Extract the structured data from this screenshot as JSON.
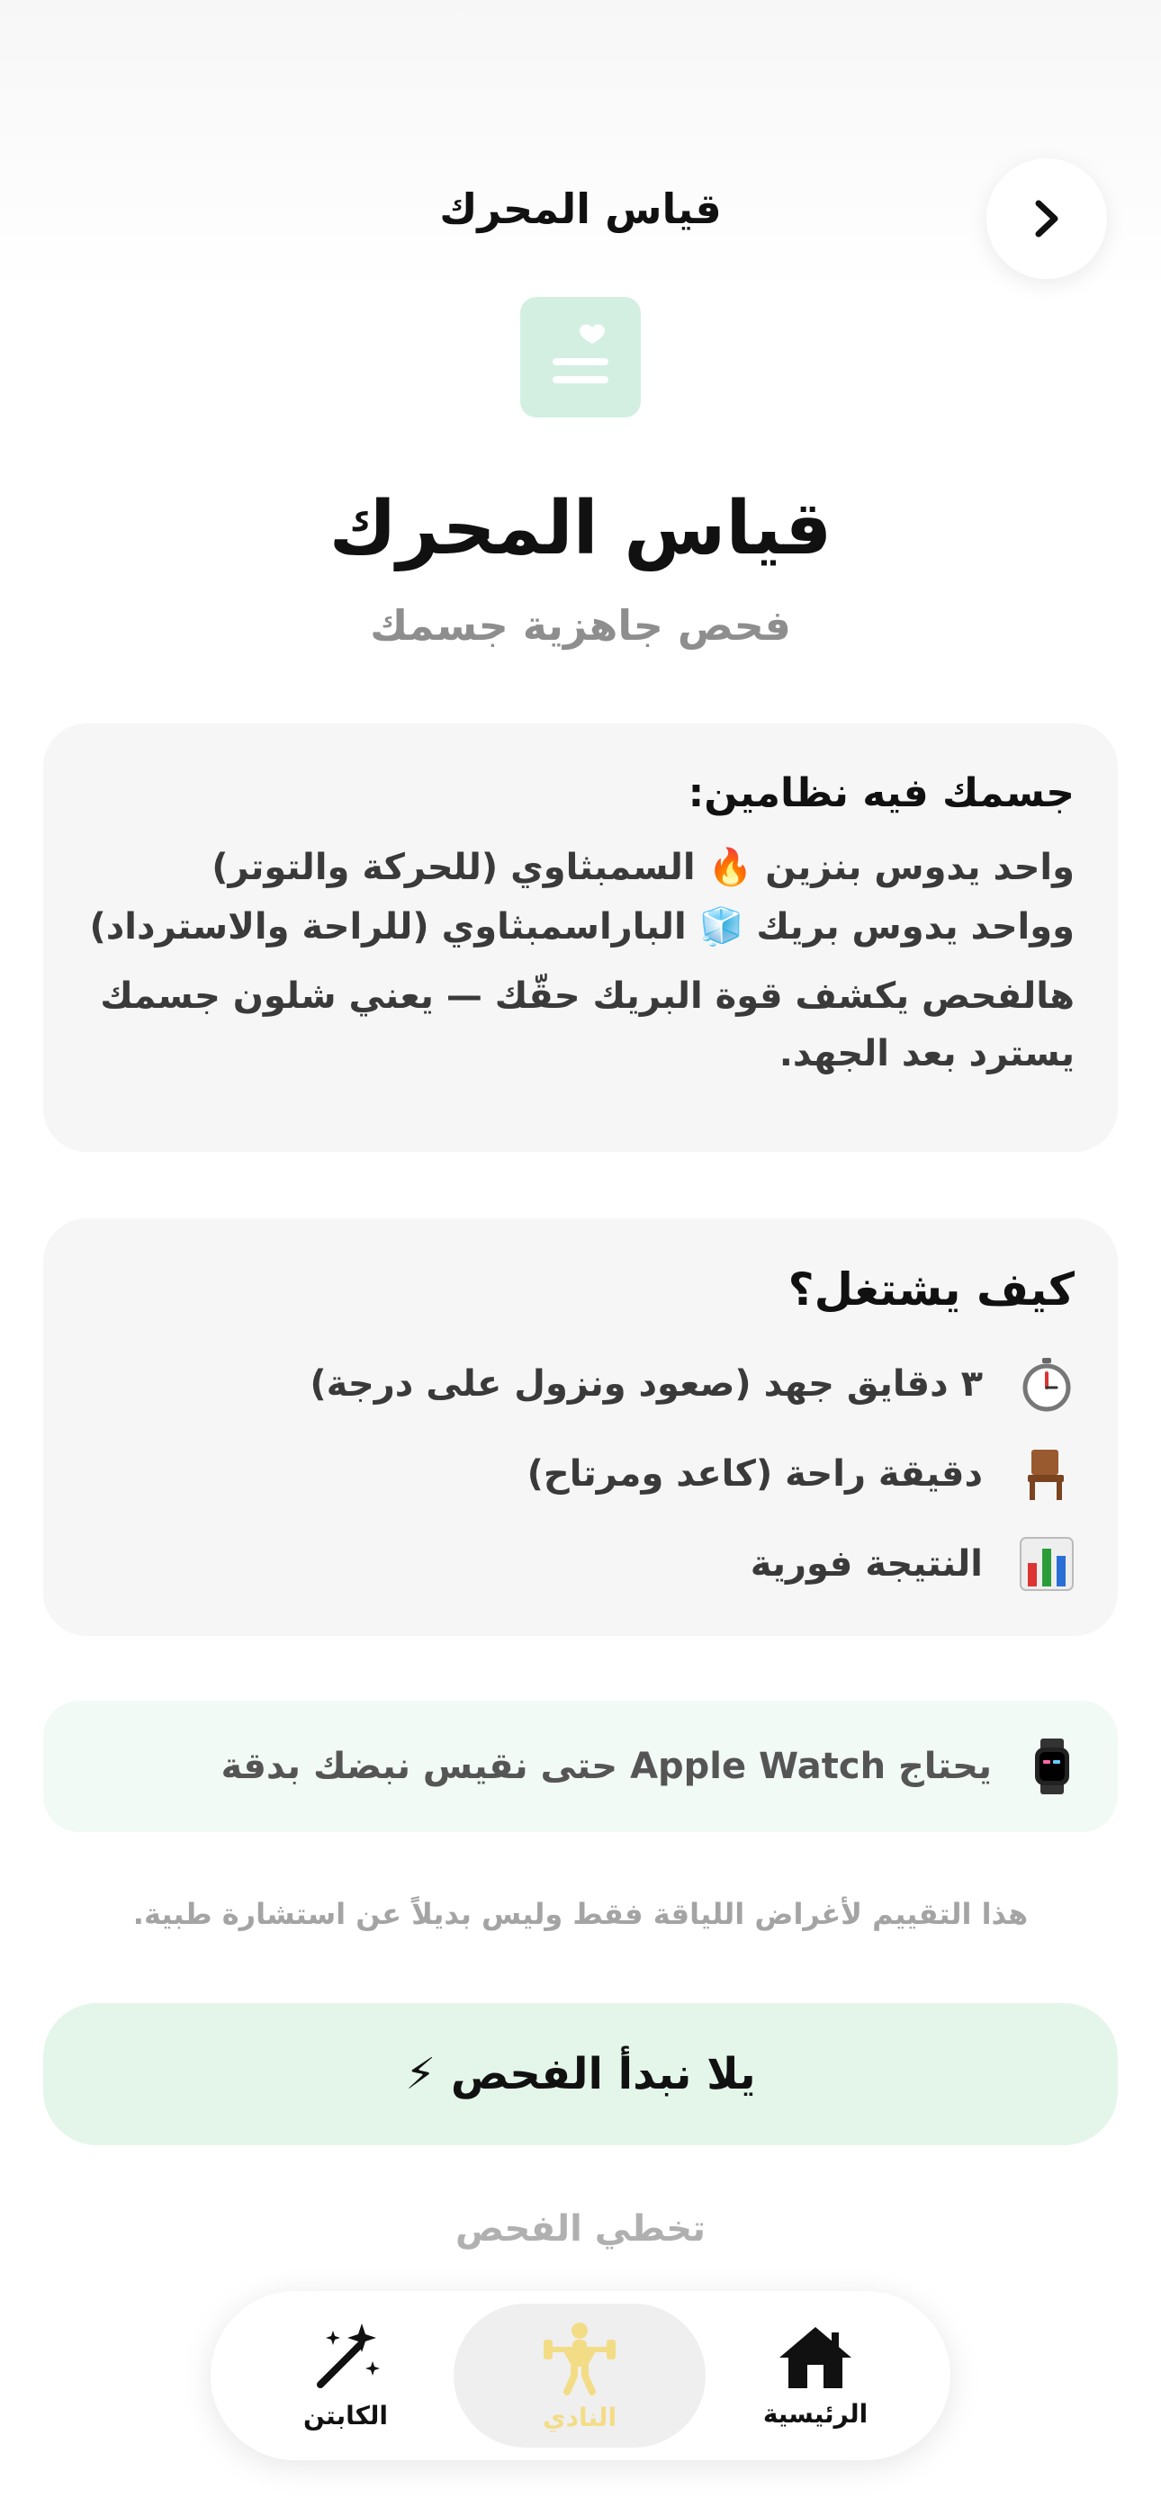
{
  "nav": {
    "title": "قياس المحرك"
  },
  "hero": {
    "title": "قياس المحرك",
    "subtitle": "فحص جاهزية جسمك"
  },
  "info_card": {
    "title": "جسمك فيه نظامين:",
    "line1": "واحد يدوس بنزين 🔥 السمبثاوي (للحركة والتوتر)",
    "line2": "وواحد يدوس بريك 🧊 الباراسمبثاوي (للراحة والاسترداد)",
    "para": "هالفحص يكشف قوة البريك حقّك — يعني شلون جسمك يسترد بعد الجهد."
  },
  "how_card": {
    "title": "كيف يشتغل؟",
    "steps": [
      {
        "icon": "stopwatch-icon",
        "text": "٣ دقايق جهد (صعود ونزول على درجة)"
      },
      {
        "icon": "chair-icon",
        "text": "دقيقة راحة (كاعد ومرتاح)"
      },
      {
        "icon": "bar-chart-icon",
        "text": "النتيجة فورية"
      }
    ]
  },
  "watch_note": {
    "icon": "watch-icon",
    "text": "يحتاج Apple Watch حتى نقيس نبضك بدقة"
  },
  "disclaimer": "هذا التقييم لأغراض اللياقة فقط وليس بديلاً عن استشارة طبية.",
  "start_button": {
    "label": "يلا نبدأ الفحص ⚡"
  },
  "skip_link": "تخطي الفحص",
  "tabbar": {
    "home": "الرئيسية",
    "club": "النادي",
    "captain": "الكابتن"
  },
  "colors": {
    "accent_green": "#d3efe2",
    "button_green": "#e4f6ea",
    "club_yellow": "#f3dc86"
  }
}
